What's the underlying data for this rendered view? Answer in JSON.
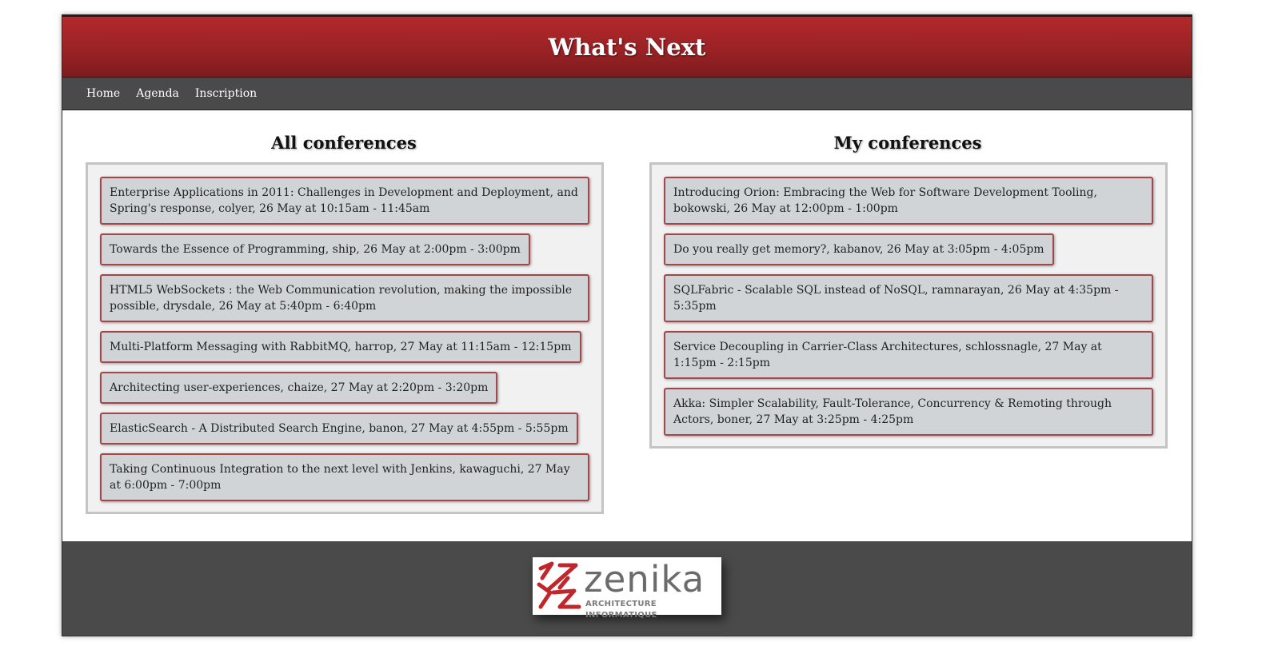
{
  "header": {
    "title": "What's Next"
  },
  "nav": {
    "items": [
      "Home",
      "Agenda",
      "Inscription"
    ]
  },
  "all_conferences": {
    "heading": "All conferences",
    "items": [
      "Enterprise Applications in 2011: Challenges in Development and Deployment, and Spring's response, colyer, 26 May at 10:15am - 11:45am",
      "Towards the Essence of Programming, ship, 26 May at 2:00pm - 3:00pm",
      "HTML5 WebSockets : the Web Communication revolution, making the impossible possible, drysdale, 26 May at 5:40pm - 6:40pm",
      "Multi-Platform Messaging with RabbitMQ, harrop, 27 May at 11:15am - 12:15pm",
      "Architecting user-experiences, chaize, 27 May at 2:20pm - 3:20pm",
      "ElasticSearch - A Distributed Search Engine, banon, 27 May at 4:55pm - 5:55pm",
      "Taking Continuous Integration to the next level with Jenkins, kawaguchi, 27 May at 6:00pm - 7:00pm"
    ]
  },
  "my_conferences": {
    "heading": "My conferences",
    "items": [
      "Introducing Orion: Embracing the Web for Software Development Tooling, bokowski, 26 May at 12:00pm - 1:00pm",
      "Do you really get memory?, kabanov, 26 May at 3:05pm - 4:05pm",
      "SQLFabric - Scalable SQL instead of NoSQL, ramnarayan, 26 May at 4:35pm - 5:35pm",
      "Service Decoupling in Carrier-Class Architectures, schlossnagle, 27 May at 1:15pm - 2:15pm",
      "Akka: Simpler Scalability, Fault-Tolerance, Concurrency & Remoting through Actors, boner, 27 May at 3:25pm - 4:25pm"
    ]
  },
  "footer": {
    "logo": {
      "name": "zenika",
      "tagline": "ARCHITECTURE INFORMATIQUE",
      "icon": "zenika-logo-icon",
      "color": "#c0272d"
    }
  }
}
